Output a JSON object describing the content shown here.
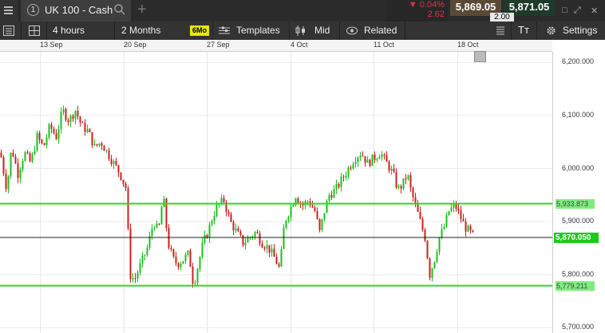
{
  "topbar": {
    "tab_number": "1",
    "instrument": "UK 100 - Cash",
    "change_pct": "▼ 0.04%",
    "change_pts": "2.62",
    "sell_price": "5,869.05",
    "buy_price": "5,871.05",
    "spread": "2.00"
  },
  "toolbar": {
    "interval": "4 hours",
    "range": "2 Months",
    "range_short": "6Mo",
    "templates": "Templates",
    "price_type": "Mid",
    "related": "Related",
    "settings": "Settings"
  },
  "colors": {
    "up": "#1bbf1b",
    "down": "#cc1f1f",
    "level_line": "#22dd22",
    "current_line": "#000000"
  },
  "chart_data": {
    "type": "candlestick",
    "x_labels": [
      "13 Sep",
      "20 Sep",
      "27 Sep",
      "4 Oct",
      "11 Oct",
      "18 Oct"
    ],
    "y_ticks": [
      "6,200.000",
      "6,100.000",
      "6,000.000",
      "5,900.000",
      "5,800.000",
      "5,700.000"
    ],
    "ylim": [
      5690,
      6220
    ],
    "current_price": "5,870.050",
    "horizontal_levels": [
      {
        "label": "5,933.873",
        "value": 5933.873
      },
      {
        "label": "5,779.211",
        "value": 5779.211
      }
    ],
    "close_path": [
      [
        0,
        6030
      ],
      [
        8,
        5960
      ],
      [
        14,
        6040
      ],
      [
        22,
        5990
      ],
      [
        30,
        6030
      ],
      [
        38,
        6010
      ],
      [
        46,
        6060
      ],
      [
        54,
        6040
      ],
      [
        62,
        6080
      ],
      [
        70,
        6060
      ],
      [
        78,
        6110
      ],
      [
        86,
        6090
      ],
      [
        94,
        6110
      ],
      [
        102,
        6080
      ],
      [
        110,
        6070
      ],
      [
        118,
        6040
      ],
      [
        126,
        6050
      ],
      [
        134,
        6030
      ],
      [
        142,
        6010
      ],
      [
        150,
        5990
      ],
      [
        158,
        5960
      ],
      [
        162,
        5800
      ],
      [
        168,
        5790
      ],
      [
        176,
        5820
      ],
      [
        184,
        5850
      ],
      [
        192,
        5900
      ],
      [
        198,
        5880
      ],
      [
        204,
        5950
      ],
      [
        210,
        5860
      ],
      [
        216,
        5830
      ],
      [
        222,
        5820
      ],
      [
        230,
        5830
      ],
      [
        236,
        5840
      ],
      [
        242,
        5780
      ],
      [
        248,
        5820
      ],
      [
        254,
        5860
      ],
      [
        260,
        5880
      ],
      [
        266,
        5910
      ],
      [
        272,
        5930
      ],
      [
        280,
        5940
      ],
      [
        288,
        5900
      ],
      [
        296,
        5880
      ],
      [
        304,
        5860
      ],
      [
        312,
        5870
      ],
      [
        320,
        5880
      ],
      [
        328,
        5860
      ],
      [
        336,
        5850
      ],
      [
        344,
        5830
      ],
      [
        350,
        5810
      ],
      [
        356,
        5900
      ],
      [
        362,
        5920
      ],
      [
        370,
        5950
      ],
      [
        378,
        5930
      ],
      [
        386,
        5940
      ],
      [
        394,
        5920
      ],
      [
        400,
        5880
      ],
      [
        406,
        5920
      ],
      [
        412,
        5950
      ],
      [
        420,
        5960
      ],
      [
        428,
        5980
      ],
      [
        436,
        6000
      ],
      [
        444,
        6020
      ],
      [
        452,
        6030
      ],
      [
        460,
        6010
      ],
      [
        468,
        6020
      ],
      [
        476,
        6030
      ],
      [
        484,
        6010
      ],
      [
        492,
        5990
      ],
      [
        498,
        5960
      ],
      [
        504,
        5970
      ],
      [
        510,
        5990
      ],
      [
        514,
        5960
      ],
      [
        520,
        5930
      ],
      [
        526,
        5900
      ],
      [
        532,
        5870
      ],
      [
        538,
        5800
      ],
      [
        544,
        5830
      ],
      [
        550,
        5870
      ],
      [
        556,
        5890
      ],
      [
        562,
        5920
      ],
      [
        570,
        5930
      ],
      [
        576,
        5910
      ],
      [
        582,
        5890
      ],
      [
        588,
        5880
      ],
      [
        594,
        5870
      ]
    ]
  }
}
